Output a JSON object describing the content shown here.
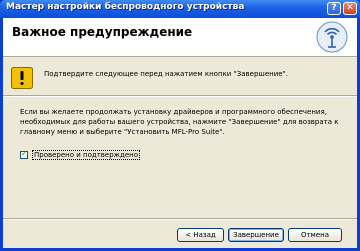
{
  "window": {
    "title": "Мастер настройки беспроводного устройства"
  },
  "titlebar_buttons": {
    "help": "?",
    "close": "✕"
  },
  "header": {
    "title": "Важное предупреждение",
    "logo_icon": "wireless-antenna-icon"
  },
  "warning": {
    "icon": "warning-exclamation-icon",
    "text": "Подтвердите следующее перед нажатием кнопки \"Завершение\"."
  },
  "body": {
    "line1": "Если вы желаете продолжать установку драйверов и программного обеспечения,",
    "line2": "необходимых для работы вашего устройства, нажмите \"Завершение\" для возврата к",
    "line3": "главному меню и выберите \"Установить MFL-Pro Suite\"."
  },
  "confirm": {
    "label": "Проверено и подтверждено",
    "checked": true
  },
  "buttons": {
    "back": "< Назад",
    "finish": "Завершение",
    "cancel": "Отмена"
  },
  "colors": {
    "accent": "#0a4ed8",
    "dialog": "#ece9d8",
    "warning_yellow": "#f2c200"
  }
}
